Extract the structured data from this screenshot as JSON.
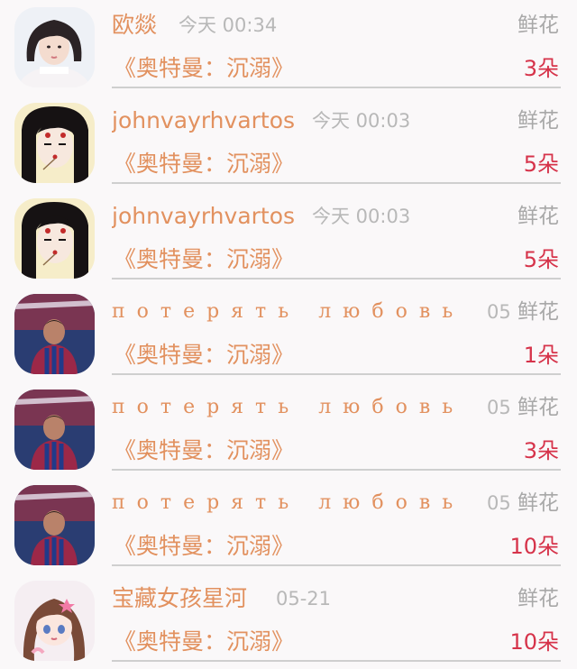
{
  "colors": {
    "name": "#e2915f",
    "time": "#b8b8b8",
    "count": "#d6334a",
    "gift": "#a8a8a8"
  },
  "records": [
    {
      "avatar": "portrait-girl-white",
      "name": "欧燚",
      "time": "今天 00:34",
      "gift": "鲜花",
      "title": "《奥特曼：沉溺》",
      "count": "3朵"
    },
    {
      "avatar": "portrait-ink-girl",
      "name": "johnvayrhvartos",
      "time": "今天 00:03",
      "gift": "鲜花",
      "title": "《奥特曼：沉溺》",
      "count": "5朵"
    },
    {
      "avatar": "portrait-ink-girl",
      "name": "johnvayrhvartos",
      "time": "今天 00:03",
      "gift": "鲜花",
      "title": "《奥特曼：沉溺》",
      "count": "5朵"
    },
    {
      "avatar": "portrait-messi",
      "name": "потерять любовь",
      "time": "05",
      "gift": "鲜花",
      "title": "《奥特曼：沉溺》",
      "count": "1朵"
    },
    {
      "avatar": "portrait-messi",
      "name": "потерять любовь",
      "time": "05",
      "gift": "鲜花",
      "title": "《奥特曼：沉溺》",
      "count": "3朵"
    },
    {
      "avatar": "portrait-messi",
      "name": "потерять любовь",
      "time": "05",
      "gift": "鲜花",
      "title": "《奥特曼：沉溺》",
      "count": "10朵"
    },
    {
      "avatar": "portrait-anime-girl",
      "name": "宝藏女孩星河",
      "time": "05-21",
      "gift": "鲜花",
      "title": "《奥特曼：沉溺》",
      "count": "10朵"
    }
  ]
}
